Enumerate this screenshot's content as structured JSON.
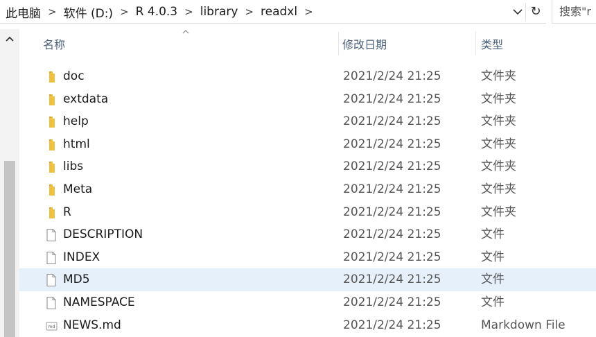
{
  "address": {
    "crumbs": [
      "此电脑",
      "软件 (D:)",
      "R 4.0.3",
      "library",
      "readxl"
    ],
    "separator": ">"
  },
  "search": {
    "placeholder": "搜索\"r"
  },
  "columns": {
    "name": "名称",
    "date": "修改日期",
    "type": "类型"
  },
  "files": [
    {
      "name": "doc",
      "date": "2021/2/24 21:25",
      "type": "文件夹",
      "kind": "folder"
    },
    {
      "name": "extdata",
      "date": "2021/2/24 21:25",
      "type": "文件夹",
      "kind": "folder"
    },
    {
      "name": "help",
      "date": "2021/2/24 21:25",
      "type": "文件夹",
      "kind": "folder"
    },
    {
      "name": "html",
      "date": "2021/2/24 21:25",
      "type": "文件夹",
      "kind": "folder"
    },
    {
      "name": "libs",
      "date": "2021/2/24 21:25",
      "type": "文件夹",
      "kind": "folder"
    },
    {
      "name": "Meta",
      "date": "2021/2/24 21:25",
      "type": "文件夹",
      "kind": "folder"
    },
    {
      "name": "R",
      "date": "2021/2/24 21:25",
      "type": "文件夹",
      "kind": "folder"
    },
    {
      "name": "DESCRIPTION",
      "date": "2021/2/24 21:25",
      "type": "文件",
      "kind": "file"
    },
    {
      "name": "INDEX",
      "date": "2021/2/24 21:25",
      "type": "文件",
      "kind": "file"
    },
    {
      "name": "MD5",
      "date": "2021/2/24 21:25",
      "type": "文件",
      "kind": "file",
      "selected": true
    },
    {
      "name": "NAMESPACE",
      "date": "2021/2/24 21:25",
      "type": "文件",
      "kind": "file"
    },
    {
      "name": "NEWS.md",
      "date": "2021/2/24 21:25",
      "type": "Markdown File",
      "kind": "markdown"
    }
  ],
  "colors": {
    "folder": "#f0c040",
    "selected_row": "#e5f0fb",
    "header_text": "#4a5f7a"
  },
  "icons": {
    "folder": "folder-icon",
    "file": "file-icon",
    "markdown": "markdown-file-icon"
  }
}
